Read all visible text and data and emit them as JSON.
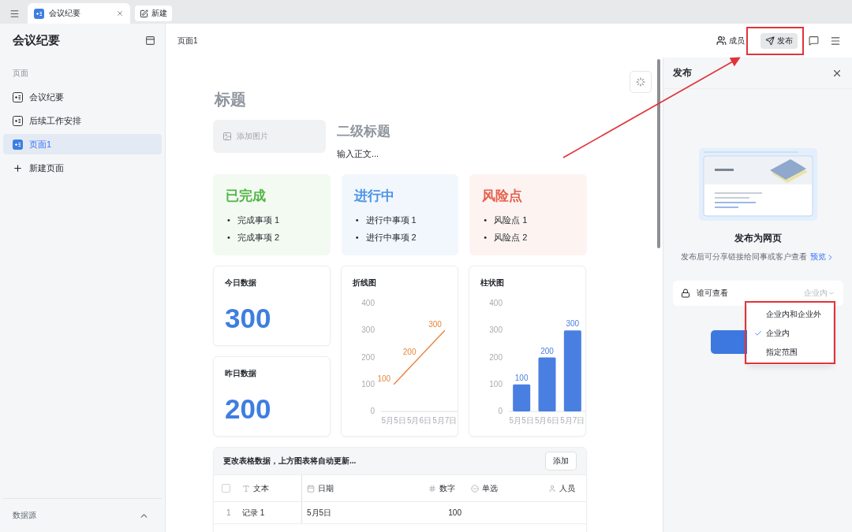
{
  "tabbar": {
    "tabs": [
      {
        "label": "会议纪要",
        "selected": true
      }
    ],
    "new_button": "新建"
  },
  "sidebar": {
    "title": "会议纪要",
    "section": "页面",
    "items": [
      {
        "label": "会议纪要",
        "selected": false
      },
      {
        "label": "后续工作安排",
        "selected": false
      },
      {
        "label": "页面1",
        "selected": true
      }
    ],
    "add_item": "新建页面",
    "footer": "数据源"
  },
  "header": {
    "breadcrumb": "页面1",
    "members": "成员",
    "publish": "发布"
  },
  "document": {
    "title": "标题",
    "image_placeholder": "添加图片",
    "subtitle": "二级标题",
    "body": "输入正文...",
    "status_cards": [
      {
        "title": "已完成",
        "color": "#52b548",
        "items": [
          {
            "marker": "•",
            "text": "完成事项 1"
          },
          {
            "marker": "•",
            "text": "完成事项 2"
          }
        ]
      },
      {
        "title": "进行中",
        "color": "#4a93e6",
        "items": [
          {
            "marker": "•",
            "text": "进行中事项 1"
          },
          {
            "marker": "•",
            "text": "进行中事项 2"
          }
        ]
      },
      {
        "title": "风险点",
        "color": "#e5604d",
        "items": [
          {
            "marker": "•",
            "text": "风险点 1"
          },
          {
            "marker": "•",
            "text": "风险点 2"
          }
        ]
      }
    ],
    "stats": [
      {
        "label": "今日数据",
        "value": "300"
      },
      {
        "label": "昨日数据",
        "value": "200"
      }
    ],
    "charts": [
      {
        "title": "折线图",
        "chart_data": {
          "type": "line",
          "categories": [
            "5月5日",
            "5月6日",
            "5月7日"
          ],
          "series": [
            {
              "color": "#e8853d",
              "values": [
                100,
                200,
                300
              ]
            }
          ],
          "ylim": [
            0,
            400
          ],
          "yticks": [
            0,
            100,
            200,
            300,
            400
          ],
          "data_labels": true
        }
      },
      {
        "title": "柱状图",
        "chart_data": {
          "type": "bar",
          "categories": [
            "5月5日",
            "5月6日",
            "5月7日"
          ],
          "series": [
            {
              "color": "#4a7fe2",
              "values": [
                100,
                200,
                300
              ]
            }
          ],
          "ylim": [
            0,
            400
          ],
          "yticks": [
            0,
            100,
            200,
            300,
            400
          ],
          "data_labels": true
        }
      }
    ],
    "table": {
      "select_all": {
        "checked": false
      },
      "note": "更改表格数据，上方图表将自动更新...",
      "add_button": "添加",
      "columns": [
        {
          "label": "文本",
          "kind": "text"
        },
        {
          "label": "日期",
          "kind": "date"
        },
        {
          "label": "数字",
          "kind": "number"
        },
        {
          "label": "单选",
          "kind": "select"
        },
        {
          "label": "人员",
          "kind": "person"
        }
      ],
      "rows": [
        {
          "index": "1",
          "cells": [
            "记录 1",
            "5月5日",
            "100",
            "",
            ""
          ]
        }
      ]
    }
  },
  "publish_panel": {
    "title": "发布",
    "heading": "发布为网页",
    "description": "发布后可分享链接给同事或客户查看",
    "preview_link": "预览",
    "visibility": {
      "label": "谁可查看",
      "value": "企业内"
    },
    "options": [
      {
        "label": "企业内和企业外",
        "selected": false
      },
      {
        "label": "企业内",
        "selected": true
      },
      {
        "label": "指定范围",
        "selected": false
      }
    ]
  }
}
